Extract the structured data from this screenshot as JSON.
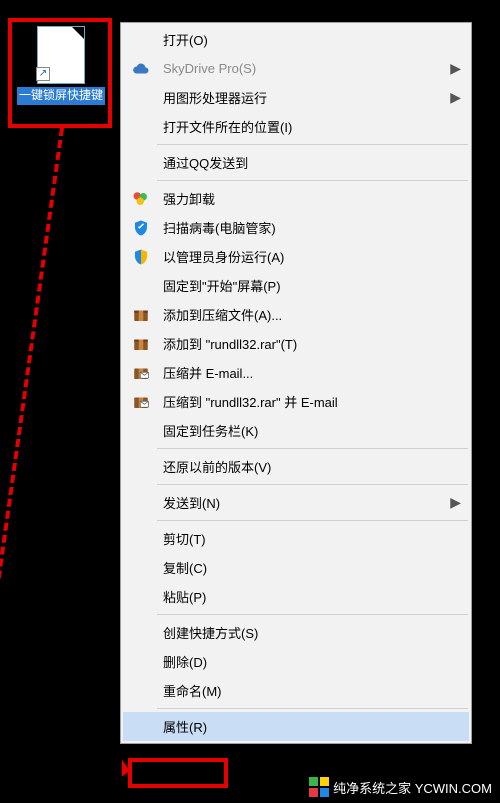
{
  "desktop": {
    "icon_label": "一键锁屏快捷键"
  },
  "menu": {
    "open": "打开(O)",
    "skydrive": "SkyDrive Pro(S)",
    "run_gfx": "用图形处理器运行",
    "open_location": "打开文件所在的位置(I)",
    "qq_send": "通过QQ发送到",
    "force_uninstall": "强力卸载",
    "scan_virus": "扫描病毒(电脑管家)",
    "run_admin": "以管理员身份运行(A)",
    "pin_start": "固定到\"开始\"屏幕(P)",
    "add_archive": "添加到压缩文件(A)...",
    "add_rundll": "添加到 \"rundll32.rar\"(T)",
    "compress_email": "压缩并 E-mail...",
    "compress_rundll_email": "压缩到 \"rundll32.rar\" 并 E-mail",
    "pin_taskbar": "固定到任务栏(K)",
    "restore_prev": "还原以前的版本(V)",
    "send_to": "发送到(N)",
    "cut": "剪切(T)",
    "copy": "复制(C)",
    "paste": "粘贴(P)",
    "create_shortcut": "创建快捷方式(S)",
    "delete": "删除(D)",
    "rename": "重命名(M)",
    "properties": "属性(R)"
  },
  "watermark": "纯净系统之家 YCWIN.COM"
}
